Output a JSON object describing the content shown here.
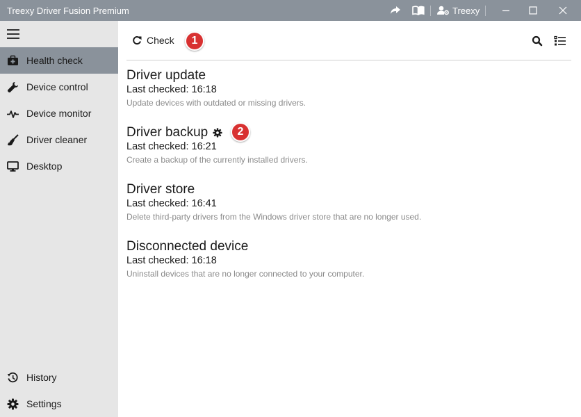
{
  "app": {
    "title": "Treexy Driver Fusion Premium",
    "user": "Treexy"
  },
  "colors": {
    "titlebar": "#8a929b",
    "sidebar_bg": "#e6e6e6",
    "active_item": "#8a929b",
    "badge": "#d83131"
  },
  "sidebar": {
    "items": [
      {
        "label": "Health check",
        "icon": "first-aid-kit-icon",
        "active": true
      },
      {
        "label": "Device control",
        "icon": "wrench-icon"
      },
      {
        "label": "Device monitor",
        "icon": "pulse-icon"
      },
      {
        "label": "Driver cleaner",
        "icon": "broom-icon"
      },
      {
        "label": "Desktop",
        "icon": "monitor-icon"
      }
    ],
    "bottom": [
      {
        "label": "History",
        "icon": "history-icon"
      },
      {
        "label": "Settings",
        "icon": "gear-icon"
      }
    ]
  },
  "toolbar": {
    "check_label": "Check",
    "badge1": "1",
    "badge2": "2"
  },
  "sections": [
    {
      "title": "Driver update",
      "checked": "Last checked: 16:18",
      "desc": "Update devices with outdated or missing drivers."
    },
    {
      "title": "Driver backup",
      "checked": "Last checked: 16:21",
      "desc": "Create a backup of the currently installed drivers."
    },
    {
      "title": "Driver store",
      "checked": "Last checked: 16:41",
      "desc": "Delete third-party drivers from the Windows driver store that are no longer used."
    },
    {
      "title": "Disconnected device",
      "checked": "Last checked: 16:18",
      "desc": "Uninstall devices that are no longer connected to your computer."
    }
  ]
}
